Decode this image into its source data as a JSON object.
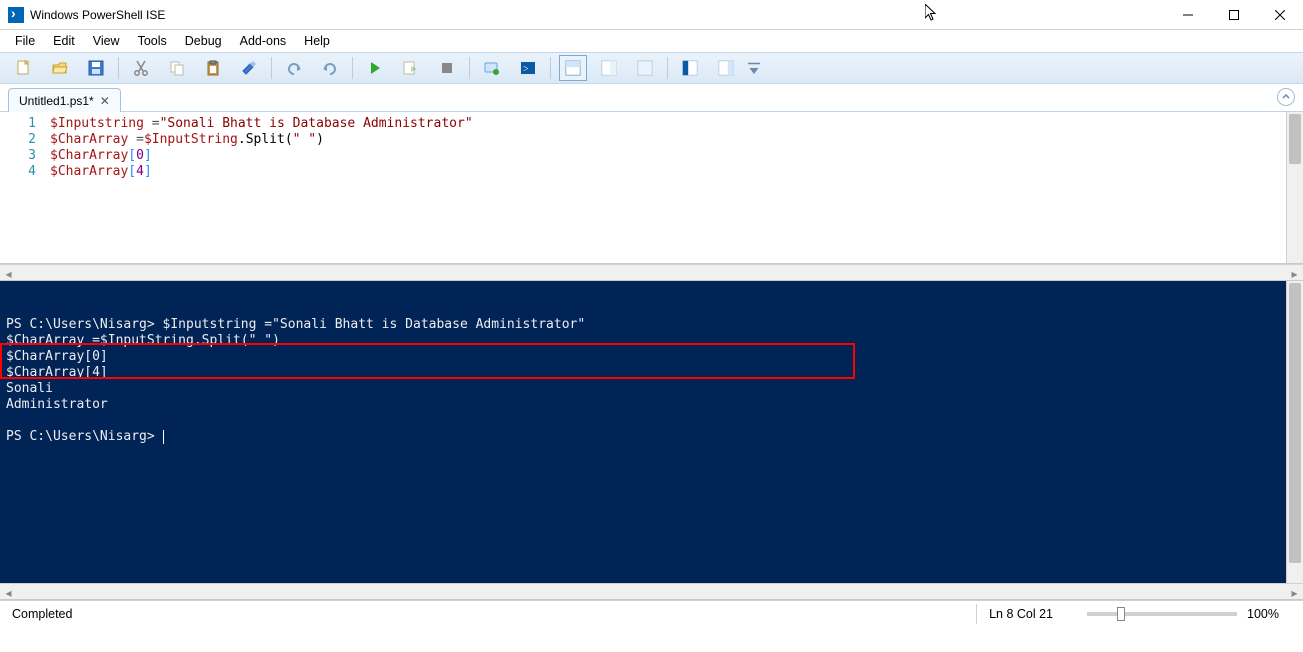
{
  "window": {
    "title": "Windows PowerShell ISE"
  },
  "menu": {
    "items": [
      "File",
      "Edit",
      "View",
      "Tools",
      "Debug",
      "Add-ons",
      "Help"
    ]
  },
  "toolbar": {
    "buttons": [
      "new",
      "open",
      "save",
      "cut",
      "copy",
      "paste",
      "clear",
      "undo",
      "redo",
      "run",
      "run-selection",
      "stop",
      "breakpoint",
      "remote",
      "show-script-top",
      "show-script-right",
      "show-script-max",
      "show-command",
      "show-command-addon"
    ]
  },
  "tab": {
    "label": "Untitled1.ps1*"
  },
  "editor": {
    "line_numbers": [
      "1",
      "2",
      "3",
      "4"
    ],
    "lines": {
      "l1": {
        "var": "$Inputstring",
        "op": " =",
        "str": "\"Sonali Bhatt is Database Administrator\""
      },
      "l2": {
        "var": "$CharArray",
        "op": " =",
        "var2": "$InputString",
        "dot": ".",
        "method": "Split",
        "open": "(",
        "arg": "\" \"",
        "close": ")"
      },
      "l3": {
        "var": "$CharArray",
        "bopen": "[",
        "num": "0",
        "bclose": "]"
      },
      "l4": {
        "var": "$CharArray",
        "bopen": "[",
        "num": "4",
        "bclose": "]"
      }
    }
  },
  "console": {
    "line1": "PS C:\\Users\\Nisarg> $Inputstring =\"Sonali Bhatt is Database Administrator\"",
    "line2": "$CharArray =$InputString.Split(\" \")",
    "line3": "$CharArray[0]",
    "line4": "$CharArray[4]",
    "out1": "Sonali",
    "out2": "Administrator",
    "prompt2": "PS C:\\Users\\Nisarg> "
  },
  "status": {
    "left": "Completed",
    "pos": "Ln 8  Col 21",
    "zoom": "100%"
  }
}
